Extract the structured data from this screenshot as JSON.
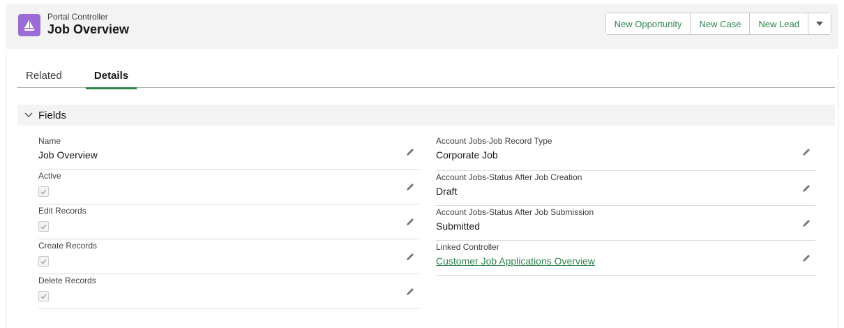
{
  "header": {
    "object_label": "Portal Controller",
    "record_title": "Job Overview",
    "icon": "sailboat-icon",
    "brand_color": "#9b6bd6",
    "actions": [
      "New Opportunity",
      "New Case",
      "New Lead"
    ]
  },
  "tabs": {
    "related": "Related",
    "details": "Details",
    "active": "Details"
  },
  "section": {
    "title": "Fields",
    "expanded": true
  },
  "fields_left": [
    {
      "label": "Name",
      "value": "Job Overview"
    },
    {
      "label": "Active",
      "checked": true
    },
    {
      "label": "Edit Records",
      "checked": true
    },
    {
      "label": "Create Records",
      "checked": true
    },
    {
      "label": "Delete Records",
      "checked": true
    }
  ],
  "fields_right": [
    {
      "label": "Account Jobs-Job Record Type",
      "value": "Corporate Job"
    },
    {
      "label": "Account Jobs-Status After Job Creation",
      "value": "Draft"
    },
    {
      "label": "Account Jobs-Status After Job Submission",
      "value": "Submitted"
    },
    {
      "label": "Linked Controller",
      "value": "Customer Job Applications Overview",
      "is_link": true
    }
  ],
  "colors": {
    "accent": "#2e844a",
    "header_bg": "#f3f3f3"
  }
}
